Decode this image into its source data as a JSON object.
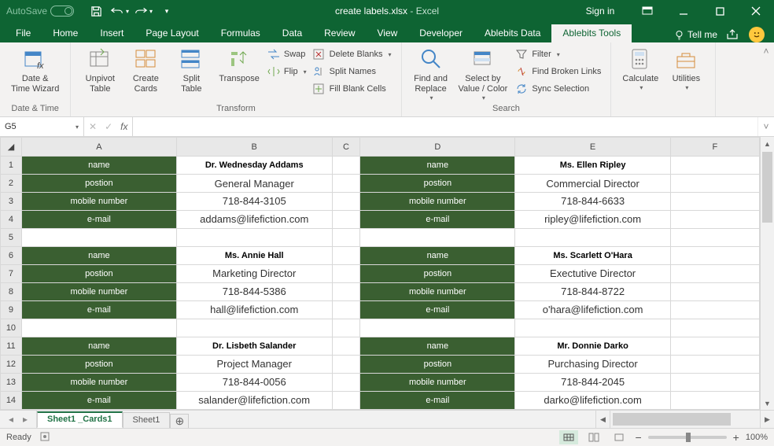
{
  "titlebar": {
    "autosave": "AutoSave",
    "autosave_state": "Off",
    "filename": "create labels.xlsx",
    "sep": "  -  ",
    "app": "Excel",
    "signin": "Sign in"
  },
  "tabs": {
    "file": "File",
    "home": "Home",
    "insert": "Insert",
    "pagelayout": "Page Layout",
    "formulas": "Formulas",
    "data": "Data",
    "review": "Review",
    "view": "View",
    "developer": "Developer",
    "abledata": "Ablebits Data",
    "abletools": "Ablebits Tools",
    "tellme": "Tell me"
  },
  "ribbon": {
    "grp_datetime": "Date & Time",
    "datetime": "Date &\nTime Wizard",
    "grp_transform": "Transform",
    "unpivot": "Unpivot\nTable",
    "createcards": "Create\nCards",
    "split": "Split\nTable",
    "transpose": "Transpose",
    "swap": "Swap",
    "flip": "Flip",
    "deleteblanks": "Delete Blanks",
    "splitnames": "Split Names",
    "fillblank": "Fill Blank Cells",
    "findreplace": "Find and\nReplace",
    "selectby": "Select by\nValue / Color",
    "filter": "Filter",
    "findlinks": "Find Broken Links",
    "syncsel": "Sync Selection",
    "grp_search": "Search",
    "calculate": "Calculate",
    "utilities": "Utilities"
  },
  "fbar": {
    "cell": "G5",
    "fx": "fx"
  },
  "cols": [
    "A",
    "B",
    "C",
    "D",
    "E",
    "F"
  ],
  "rows": [
    1,
    2,
    3,
    4,
    5,
    6,
    7,
    8,
    9,
    10,
    11,
    12,
    13,
    14
  ],
  "labels": {
    "name": "name",
    "postion": "postion",
    "mobile": "mobile number",
    "email": "e-mail"
  },
  "cards": {
    "r1": {
      "b": "Dr. Wednesday Addams",
      "e": "Ms. Ellen Ripley"
    },
    "r2": {
      "b": "General Manager",
      "e": "Commercial Director"
    },
    "r3": {
      "b": "718-844-3105",
      "e": "718-844-6633"
    },
    "r4": {
      "b": "addams@lifefiction.com",
      "e": "ripley@lifefiction.com"
    },
    "r6": {
      "b": "Ms. Annie Hall",
      "e": "Ms. Scarlett O'Hara"
    },
    "r7": {
      "b": "Marketing Director",
      "e": "Exectutive Director"
    },
    "r8": {
      "b": "718-844-5386",
      "e": "718-844-8722"
    },
    "r9": {
      "b": "hall@lifefiction.com",
      "e": "o'hara@lifefiction.com"
    },
    "r11": {
      "b": "Dr. Lisbeth Salander",
      "e": "Mr. Donnie Darko"
    },
    "r12": {
      "b": "Project Manager",
      "e": "Purchasing Director"
    },
    "r13": {
      "b": "718-844-0056",
      "e": "718-844-2045"
    },
    "r14": {
      "b": "salander@lifefiction.com",
      "e": "darko@lifefiction.com"
    }
  },
  "sheets": {
    "active": "Sheet1 _Cards1",
    "other": "Sheet1"
  },
  "status": {
    "ready": "Ready",
    "zoom": "100%"
  }
}
